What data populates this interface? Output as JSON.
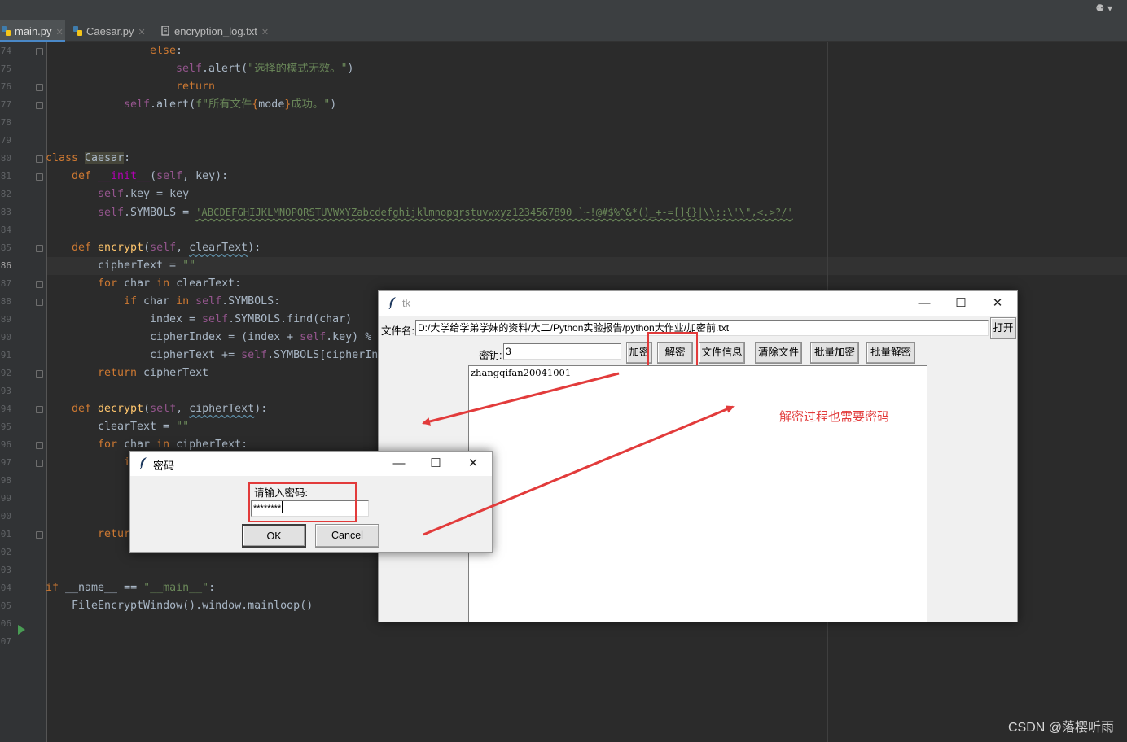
{
  "ide": {
    "tabs": [
      {
        "label": "main.py",
        "icon": "python-file-icon"
      },
      {
        "label": "Caesar.py",
        "icon": "python-file-icon"
      },
      {
        "label": "encryption_log.txt",
        "icon": "text-file-icon"
      }
    ],
    "user_menu": "⚉ ▾",
    "line_numbers": [
      "74",
      "75",
      "76",
      "77",
      "78",
      "79",
      "80",
      "81",
      "82",
      "83",
      "84",
      "85",
      "86",
      "87",
      "88",
      "89",
      "90",
      "91",
      "92",
      "93",
      "94",
      "95",
      "96",
      "97",
      "98",
      "99",
      "00",
      "01",
      "02",
      "03",
      "04",
      "05",
      "06",
      "07"
    ],
    "code": {
      "l74_kw": "else",
      "l74_p": ":",
      "l75_self": "self",
      "l75_a": ".alert(",
      "l75_s": "\"选择的模式无效。\"",
      "l75_b": ")",
      "l76_kw": "return",
      "l77_self": "self",
      "l77_a": ".alert(",
      "l77_s1": "f\"所有文件",
      "l77_br1": "{",
      "l77_var": "mode",
      "l77_br2": "}",
      "l77_s2": "成功。\"",
      "l77_b": ")",
      "l80_kw": "class ",
      "l80_name": "Caesar",
      "l80_p": ":",
      "l81_kw": "def ",
      "l81_fn": "__init__",
      "l81_p1": "(",
      "l81_self": "self",
      "l81_p2": ", key):",
      "l82_self": "self",
      "l82_rest": ".key = key",
      "l83_self": "self",
      "l83_rest": ".SYMBOLS = ",
      "l83_str": "'ABCDEFGHIJKLMNOPQRSTUVWXYZabcdefghijklmnopqrstuvwxyz1234567890 `~!@#$%^&*()_+-=[]{}|\\\\;:\\'\\\",<.>?/'",
      "l85_kw": "def ",
      "l85_fn": "encrypt",
      "l85_p1": "(",
      "l85_self": "self",
      "l85_p2": ", ",
      "l85_param": "clearText",
      "l85_p3": "):",
      "l86_a": "cipherText = ",
      "l86_s": "\"\"",
      "l87_kw1": "for",
      "l87_a": " char ",
      "l87_kw2": "in",
      "l87_b": " clearText:",
      "l88_kw1": "if",
      "l88_a": " char ",
      "l88_kw2": "in ",
      "l88_self": "self",
      "l88_b": ".SYMBOLS:",
      "l89_a": "index = ",
      "l89_self": "self",
      "l89_b": ".SYMBOLS.find(char)",
      "l90_a": "cipherIndex = (index + ",
      "l90_self": "self",
      "l90_b": ".key) %",
      "l91_a": "cipherText += ",
      "l91_self": "self",
      "l91_b": ".SYMBOLS[cipherIn",
      "l92_kw": "return",
      "l92_b": " cipherText",
      "l94_kw": "def ",
      "l94_fn": "decrypt",
      "l94_p1": "(",
      "l94_self": "self",
      "l94_p2": ", ",
      "l94_param": "cipherText",
      "l94_p3": "):",
      "l95_a": "clearText = ",
      "l95_s": "\"\"",
      "l96_kw1": "for",
      "l96_a": " char ",
      "l96_kw2": "in",
      "l96_b": " cipherText:",
      "l97_frag": "i",
      "l101_frag": "retur",
      "l104_kw": "if",
      "l104_a": " __name__ == ",
      "l104_s": "\"__main__\"",
      "l104_b": ":",
      "l105": "FileEncryptWindow().window.mainloop()"
    }
  },
  "tk_main": {
    "title": "tk",
    "file_label": "文件名:",
    "file_path": "D:/大学给学弟学妹的资料/大二/Python实验报告/python大作业/加密前.txt",
    "open_button": "打开",
    "key_label": "密钥:",
    "key_value": "3",
    "buttons": {
      "encrypt": "加密",
      "decrypt": "解密",
      "file_info": "文件信息",
      "clear_file": "清除文件",
      "batch_encrypt": "批量加密",
      "batch_decrypt": "批量解密"
    },
    "text_content": "zhangqifan20041001"
  },
  "password_dialog": {
    "title": "密码",
    "prompt": "请输入密码:",
    "value": "********",
    "ok": "OK",
    "cancel": "Cancel"
  },
  "annotation": {
    "text": "解密过程也需要密码",
    "color": "#e23b3b"
  },
  "watermark": "CSDN @落樱听雨"
}
